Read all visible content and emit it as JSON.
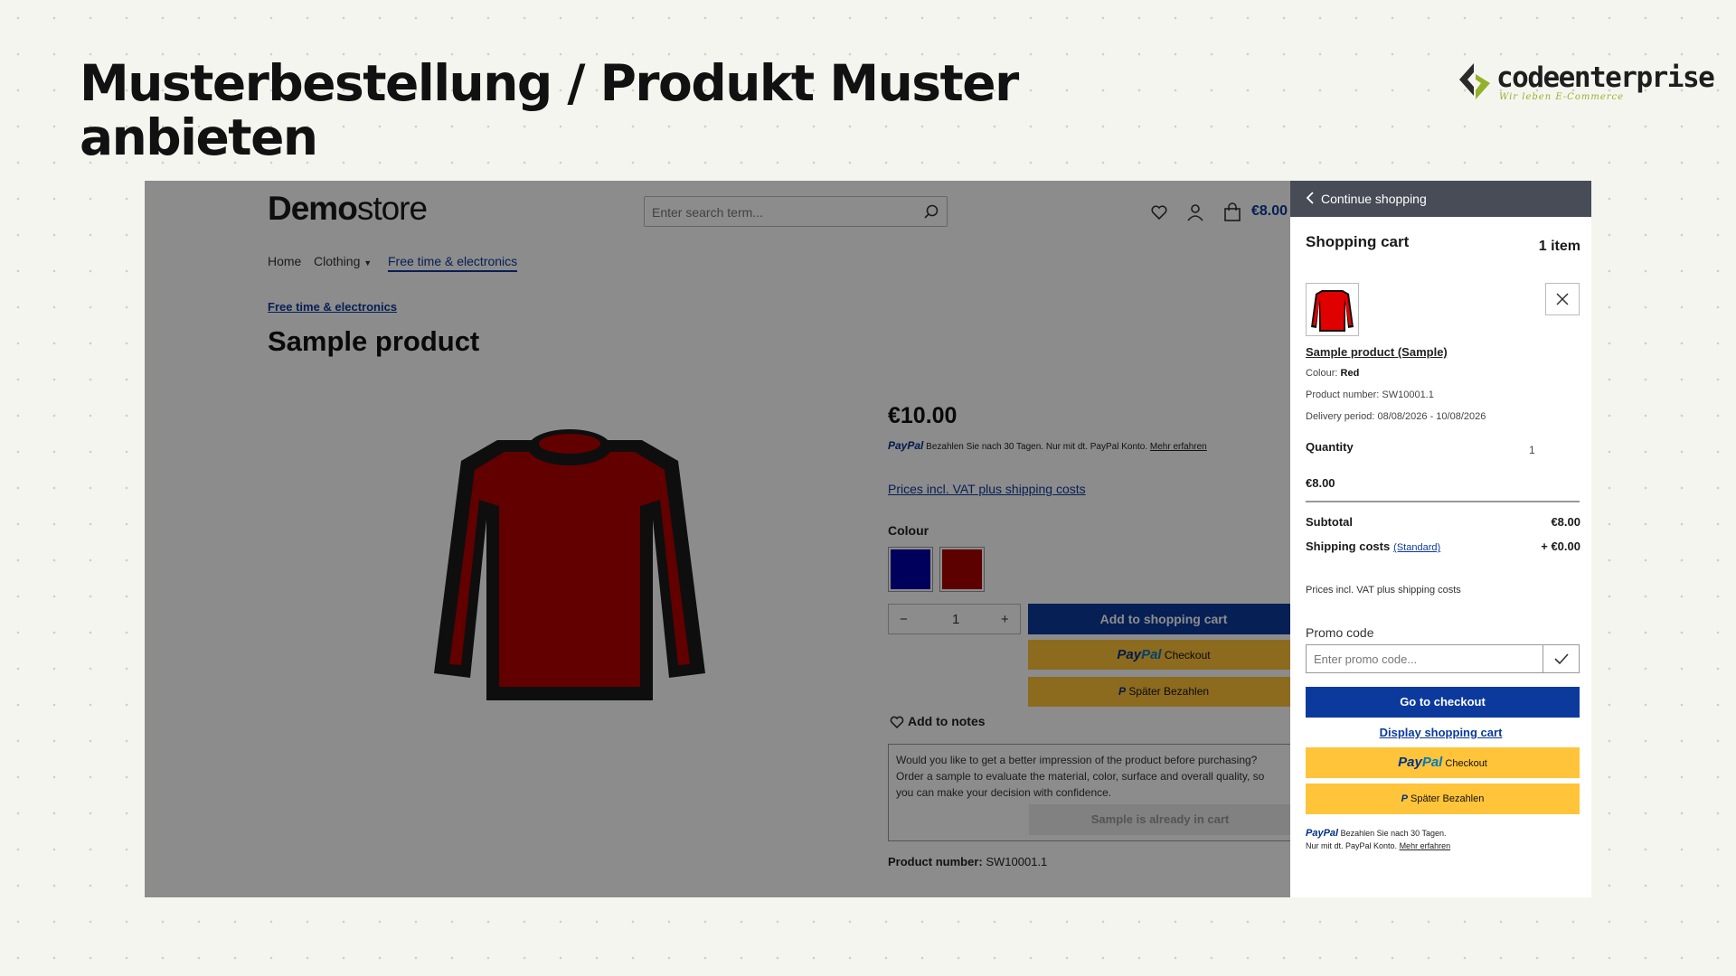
{
  "slide": {
    "title": "Musterbestellung / Produkt Muster anbieten",
    "brand_name": "codeenterprise",
    "brand_tagline": "Wir leben E-Commerce",
    "brand_color": "#93b12a"
  },
  "store": {
    "logo_bold": "Demo",
    "logo_light": "store",
    "search_placeholder": "Enter search term...",
    "cart_total": "€8.00",
    "nav": {
      "home": "Home",
      "clothing": "Clothing",
      "free_time": "Free time & electronics"
    },
    "breadcrumb": "Free time & electronics",
    "product_title": "Sample product",
    "price": "€10.00",
    "paypal_brand": "PayPal",
    "paypal_text": "Bezahlen Sie nach 30 Tagen. Nur mit dt. PayPal Konto.",
    "paypal_more": "Mehr erfahren",
    "vat_link": "Prices incl. VAT plus shipping costs",
    "colour_label": "Colour",
    "swatches": {
      "blue": "#0000a8",
      "red": "#a80000"
    },
    "quantity": "1",
    "qty_minus": "−",
    "qty_plus": "+",
    "add_to_cart": "Add to shopping cart",
    "pp_checkout_brand_a": "Pay",
    "pp_checkout_brand_b": "Pal",
    "pp_checkout_label": "Checkout",
    "pp_later_label": "Später Bezahlen",
    "add_to_notes": "Add to notes",
    "sample_text": "Would you like to get a better impression of the product before purchasing? Order a sample to evaluate the material, color, surface and overall quality, so you can make your decision with confidence.",
    "sample_button": "Sample is already in cart",
    "product_number_label": "Product number:",
    "product_number": "SW10001.1",
    "accent_color": "#0b3a9c",
    "paypal_color": "#ffc439"
  },
  "offcanvas": {
    "continue": "Continue shopping",
    "title": "Shopping cart",
    "item_count": "1 item",
    "item_name": "Sample product (Sample)",
    "colour_label": "Colour:",
    "colour_value": "Red",
    "product_number": "Product number: SW10001.1",
    "delivery": "Delivery period: 08/08/2026 - 10/08/2026",
    "quantity_label": "Quantity",
    "quantity_value": "1",
    "line_price": "€8.00",
    "subtotal_label": "Subtotal",
    "subtotal_value": "€8.00",
    "shipping_label": "Shipping costs",
    "shipping_method": "(Standard)",
    "shipping_value": "+ €0.00",
    "vat_note": "Prices incl. VAT plus shipping costs",
    "promo_label": "Promo code",
    "promo_placeholder": "Enter promo code...",
    "checkout": "Go to checkout",
    "display_cart": "Display shopping cart",
    "pp_checkout_label": "Checkout",
    "pp_later_label": "Später Bezahlen",
    "fine_line1": "Bezahlen Sie nach 30 Tagen.",
    "fine_line2": "Nur mit dt. PayPal Konto.",
    "fine_more": "Mehr erfahren"
  }
}
